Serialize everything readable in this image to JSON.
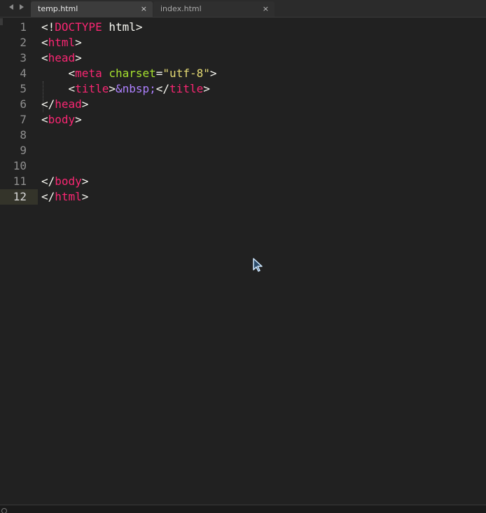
{
  "tabs": [
    {
      "label": "temp.html",
      "close": "×",
      "active": true
    },
    {
      "label": "index.html",
      "close": "×",
      "active": false
    }
  ],
  "nav": {
    "back_icon": "chevron-left-icon",
    "forward_icon": "chevron-right-icon"
  },
  "editor": {
    "current_line": 12,
    "lines": [
      {
        "num": "1"
      },
      {
        "num": "2"
      },
      {
        "num": "3"
      },
      {
        "num": "4"
      },
      {
        "num": "5"
      },
      {
        "num": "6"
      },
      {
        "num": "7"
      },
      {
        "num": "8"
      },
      {
        "num": "9"
      },
      {
        "num": "10"
      },
      {
        "num": "11"
      },
      {
        "num": "12"
      }
    ],
    "code": {
      "l1": {
        "p1": "<!",
        "t1": "DOCTYPE",
        "p2": " html>"
      },
      "l2": {
        "p1": "<",
        "t1": "html",
        "p2": ">"
      },
      "l3": {
        "p1": "<",
        "t1": "head",
        "p2": ">"
      },
      "l4": {
        "indent": "    ",
        "p1": "<",
        "t1": "meta",
        "sp": " ",
        "a1": "charset",
        "eq": "=",
        "s1": "\"utf-8\"",
        "p2": ">"
      },
      "l5": {
        "indent": "    ",
        "p1": "<",
        "t1": "title",
        "p2": ">",
        "e1": "&nbsp;",
        "p3": "</",
        "t2": "title",
        "p4": ">"
      },
      "l6": {
        "p1": "</",
        "t1": "head",
        "p2": ">"
      },
      "l7": {
        "p1": "<",
        "t1": "body",
        "p2": ">"
      },
      "l11": {
        "p1": "</",
        "t1": "body",
        "p2": ">"
      },
      "l12": {
        "p1": "</",
        "t1": "html",
        "p2": ">"
      }
    }
  },
  "colors": {
    "background": "#212121",
    "tag": "#f92672",
    "attribute": "#a6e22e",
    "string": "#e6db74",
    "entity": "#ae81ff"
  }
}
